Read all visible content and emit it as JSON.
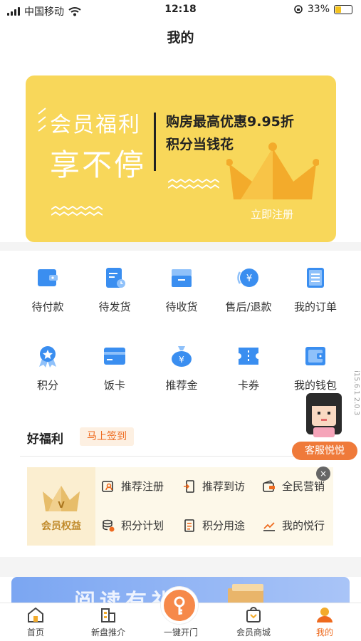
{
  "status_bar": {
    "carrier": "中国移动",
    "time": "12:18",
    "battery": "33%",
    "battery_level": 0.33
  },
  "page_title": "我的",
  "banner": {
    "line1": "会员福利",
    "line2": "享不停",
    "promo1": "购房最高优惠9.95折",
    "promo2": "积分当钱花",
    "register": "立即注册",
    "bg_color": "#f8d75a"
  },
  "orders": [
    {
      "label": "待付款",
      "icon": "wallet-icon"
    },
    {
      "label": "待发货",
      "icon": "document-clock-icon"
    },
    {
      "label": "待收货",
      "icon": "box-icon"
    },
    {
      "label": "售后/退款",
      "icon": "yen-refund-icon"
    },
    {
      "label": "我的订单",
      "icon": "list-icon"
    }
  ],
  "services": [
    {
      "label": "积分",
      "icon": "medal-icon"
    },
    {
      "label": "饭卡",
      "icon": "card-icon"
    },
    {
      "label": "推荐金",
      "icon": "money-bag-icon"
    },
    {
      "label": "卡券",
      "icon": "coupon-icon"
    },
    {
      "label": "我的钱包",
      "icon": "purse-icon"
    }
  ],
  "welfare": {
    "title": "好福利",
    "sign_in": "马上签到"
  },
  "benefits": {
    "badge_label": "会员权益",
    "badge_letter": "V",
    "items": [
      {
        "label": "推荐注册",
        "icon": "user-card-icon"
      },
      {
        "label": "推荐到访",
        "icon": "door-icon"
      },
      {
        "label": "全民营销",
        "icon": "wallet-share-icon"
      },
      {
        "label": "积分计划",
        "icon": "coins-icon"
      },
      {
        "label": "积分用途",
        "icon": "receipt-icon"
      },
      {
        "label": "我的悦行",
        "icon": "trend-icon"
      }
    ]
  },
  "close_symbol": "×",
  "ad": {
    "text": "阅读有礼"
  },
  "customer_service": {
    "label": "客服悦悦"
  },
  "version": "i15.6.1 2.0.3",
  "tabs": [
    {
      "label": "首页",
      "icon": "home-icon"
    },
    {
      "label": "新盘推介",
      "icon": "building-icon"
    },
    {
      "label": "一键开门",
      "icon": "key-icon"
    },
    {
      "label": "会员商城",
      "icon": "shopping-bag-icon"
    },
    {
      "label": "我的",
      "icon": "person-icon",
      "active": true
    }
  ],
  "colors": {
    "accent": "#ee6a1e",
    "icon_blue": "#3a8ef0",
    "banner": "#f8d75a"
  }
}
